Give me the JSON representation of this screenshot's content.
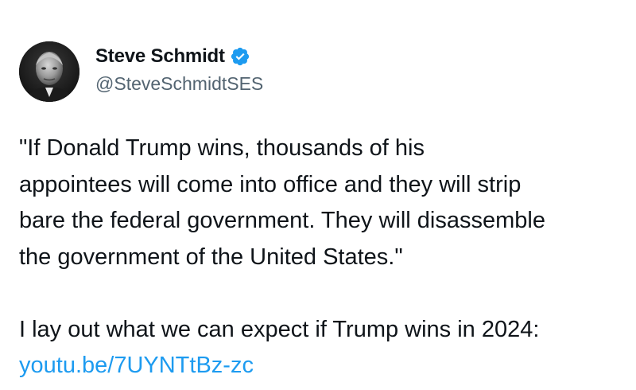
{
  "author": {
    "display_name": "Steve Schmidt",
    "handle": "@SteveSchmidtSES",
    "verified": true,
    "verified_color": "#1d9bf0",
    "avatar_icon": "person-photo-avatar"
  },
  "tweet": {
    "quote_lines": [
      "\"If Donald Trump wins, thousands of his",
      "appointees will come into office and they will strip",
      "bare the federal government. They will disassemble",
      "the government of the United States.\""
    ],
    "intro_line": "I lay out what we can expect if Trump wins in 2024:",
    "link_text": "youtu.be/7UYNTtBz-zc",
    "link_color": "#1d9bf0"
  }
}
